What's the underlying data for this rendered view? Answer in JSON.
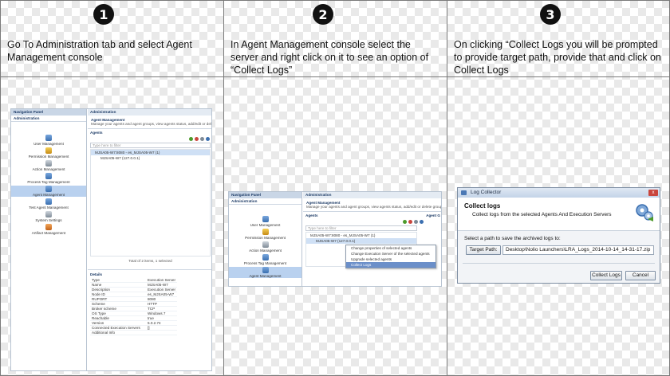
{
  "steps": [
    {
      "number": "1",
      "caption": "Go To Administration tab and select Agent Management console"
    },
    {
      "number": "2",
      "caption": "In Agent Management console select the server and right click on it to see an option of “Collect Logs”"
    },
    {
      "number": "3",
      "caption": "On clicking “Collect Logs you will be prompted to provide target path, provide that and click on Collect Logs"
    }
  ],
  "shot1": {
    "nav_header": "Navigation Panel",
    "nav_section": "Administration",
    "nav_items": [
      {
        "label": "User Management",
        "icon": "users-icon"
      },
      {
        "label": "Permission Management",
        "icon": "lock-icon"
      },
      {
        "label": "Action Management",
        "icon": "action-icon"
      },
      {
        "label": "Process Tag Management",
        "icon": "tag-icon"
      },
      {
        "label": "Agent Management",
        "icon": "agent-icon",
        "selected": true
      },
      {
        "label": "Test Agent Management",
        "icon": "test-agent-icon"
      },
      {
        "label": "System Settings",
        "icon": "settings-icon"
      },
      {
        "label": "Artifact Management",
        "icon": "artifact-icon"
      }
    ],
    "main_header": "Administration",
    "console_title": "Agent Management",
    "console_desc": "Manage your agents and agent groups, view agents status, add/edit or delete gr",
    "agents_label": "Agents",
    "filter_placeholder": "Type here to filter",
    "tree": [
      "MJSA05-W7:8080 - es_MJSA05-W7 (1)",
      "MJSA05-W7 (127.0.0.1)"
    ],
    "count_text": "Total of 2 items, 1 selected",
    "details_label": "Details",
    "details": [
      [
        "Type",
        "Execution Server"
      ],
      [
        "Name",
        "MJSA05-W7"
      ],
      [
        "Description",
        "Execution Server"
      ],
      [
        "Node ID",
        "es_MJSA05-W7"
      ],
      [
        "RUPORT",
        "8080"
      ],
      [
        "Scheme",
        "HTTP"
      ],
      [
        "Broker scheme",
        "TCP"
      ],
      [
        "OS Type",
        "Windows 7"
      ],
      [
        "Reachable",
        "true"
      ],
      [
        "Version",
        "5.0.2.74"
      ],
      [
        "Connected Execution Servers",
        "[]"
      ],
      [
        "Additional Info",
        ""
      ]
    ]
  },
  "shot2": {
    "nav_header": "Navigation Panel",
    "nav_section": "Administration",
    "nav_items": [
      {
        "label": "User Management",
        "icon": "users-icon"
      },
      {
        "label": "Permission Management",
        "icon": "lock-icon"
      },
      {
        "label": "Action Management",
        "icon": "action-icon"
      },
      {
        "label": "Process Tag Management",
        "icon": "tag-icon"
      },
      {
        "label": "Agent Management",
        "icon": "agent-icon",
        "selected": true
      }
    ],
    "main_header": "Administration",
    "console_title": "Agent Management",
    "console_desc": "Manage your agents and agent groups, view agents status, add/edit or delete groups, etc.",
    "agents_label": "Agents",
    "agent_label_right": "Agent G",
    "filter_placeholder": "Type here to filter",
    "tree": [
      "MJSA05-W7:8080 - es_MJSA05-W7 (1)",
      "MJSA05-W7 (127.0.0.1)"
    ],
    "context_menu": [
      "Change properties of selected agents",
      "Change Execution Server of the selected agents",
      "Upgrade selected agents",
      "Collect Logs"
    ]
  },
  "shot3": {
    "window_title": "Log Collector",
    "close_glyph": "x",
    "heading": "Collect logs",
    "subheading": "Collect logs from the selected Agents And Execution Servers",
    "prompt": "Select a path to save the archived logs to:",
    "target_button": "Target Path:",
    "target_value": "Desktop\\Nolio Launchers\\LRA_Logs_2014-10-14_14-31-17.zip",
    "collect_button": "Collect Logs",
    "cancel_button": "Cancel"
  },
  "colors": {
    "accent": "#1d3b66",
    "selection": "#b9d1ef",
    "menu_highlight": "#6b8fc9"
  }
}
